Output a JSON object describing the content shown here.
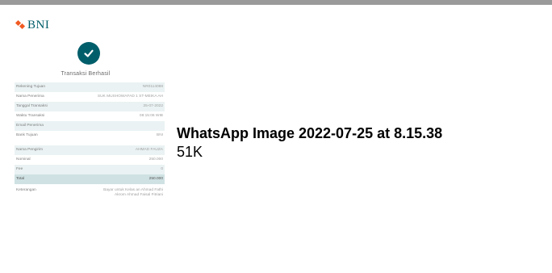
{
  "thumbnail": {
    "logo_text": "BNI",
    "status_text": "Transaksi Berhasil",
    "rows_section_a": [
      {
        "label": "Rekening Tujuan",
        "value": "NR0114088",
        "shade": true
      },
      {
        "label": "Nama Penerima",
        "value": "SUK MUSHOWAFAD 1 ST-MEIKA AH",
        "shade": false
      },
      {
        "label": "Tanggal Transaksi",
        "value": "25-07-2022",
        "shade": true
      },
      {
        "label": "Waktu Transaksi",
        "value": "08:15:06 WIB",
        "shade": false
      },
      {
        "label": "Email Penerima",
        "value": "",
        "shade": true
      },
      {
        "label": "Bank Tujuan",
        "value": "BNI",
        "shade": false
      }
    ],
    "rows_section_b": [
      {
        "label": "Nama Pengirim",
        "value": "AHMAD FAUZA",
        "shade": true
      },
      {
        "label": "Nominal",
        "value": "250.000",
        "shade": false
      },
      {
        "label": "Fee",
        "value": "0",
        "shade": true
      }
    ],
    "total": {
      "label": "Total",
      "value": "250.000"
    },
    "note": {
      "label": "Keterangan",
      "value": "Bayar untuk Kelas an Ahmad Fathi Akrom Ahmad Faisal Fitriani"
    }
  },
  "file": {
    "name": "WhatsApp Image 2022-07-25 at 8.15.38",
    "size": "51K"
  },
  "colors": {
    "brand_teal": "#005e6a",
    "brand_orange": "#f15a22",
    "row_shade": "#eaf2f3",
    "top_bar": "#9a9a9a"
  }
}
